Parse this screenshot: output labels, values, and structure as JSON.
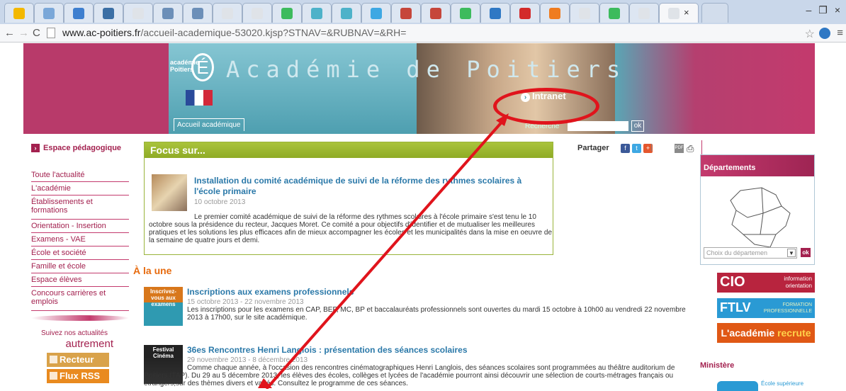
{
  "browser": {
    "url_host": "www.ac-poitiers.fr",
    "url_path": "/accueil-academique-53020.kjsp?STNAV=&RUBNAV=&RH=",
    "active_tab_close": "×",
    "tabs": [
      {
        "icon": "photo-icon",
        "color": "#f3b800"
      },
      {
        "icon": "photo-icon",
        "color": "#7aa7d8"
      },
      {
        "icon": "calendar-icon",
        "color": "#3e7fcf"
      },
      {
        "icon": "blog-icon",
        "color": "#3b6fa5"
      },
      {
        "icon": "page-icon",
        "color": "#dfe3e8"
      },
      {
        "icon": "slide-icon",
        "color": "#6c8fb8"
      },
      {
        "icon": "slide-icon",
        "color": "#6c8fb8"
      },
      {
        "icon": "page-icon",
        "color": "#dfe3e8"
      },
      {
        "icon": "page-icon",
        "color": "#dfe3e8"
      },
      {
        "icon": "drive-icon",
        "color": "#3dbb5d"
      },
      {
        "icon": "circle-icon",
        "color": "#4eb2c9"
      },
      {
        "icon": "circle-icon",
        "color": "#4eb2c9"
      },
      {
        "icon": "twitter-icon",
        "color": "#3ea8e3"
      },
      {
        "icon": "record-icon",
        "color": "#c6463b"
      },
      {
        "icon": "record-icon",
        "color": "#c6463b"
      },
      {
        "icon": "drive-icon",
        "color": "#3dbb5d"
      },
      {
        "icon": "circle-icon",
        "color": "#2f78c4"
      },
      {
        "icon": "free-icon",
        "color": "#d32a2a"
      },
      {
        "icon": "orange-icon",
        "color": "#ef7c1f"
      },
      {
        "icon": "page-icon",
        "color": "#dfe3e8"
      },
      {
        "icon": "drive-icon",
        "color": "#3dbb5d"
      },
      {
        "icon": "page-icon",
        "color": "#dfe3e8"
      }
    ]
  },
  "banner": {
    "logo_text": "académie\nPoitiers",
    "logo_letter": "É",
    "brand": "Académie de Poitiers",
    "accueil_tab": "Accueil académique",
    "intranet_label": "Intranet",
    "search_label": "Recherche",
    "search_button": "ok"
  },
  "left": {
    "espace_pedagogique": "Espace pédagogique",
    "nav": [
      "Toute l'actualité",
      "L'académie",
      "Établissements et formations",
      "Orientation - Insertion",
      "Examens - VAE",
      "École et société",
      "Famille et école",
      "Espace élèves",
      "Concours carrières et emplois"
    ],
    "suivez": "Suivez nos actualités",
    "autrement": "autrement",
    "recteur": "Recteur",
    "rss": "Flux RSS"
  },
  "focus": {
    "header": "Focus sur...",
    "title": "Installation du comité académique de suivi de la réforme des rythmes scolaires à l'école primaire",
    "date": "10 octobre 2013",
    "text": "Le premier comité académique de suivi de la réforme des rythmes scolaires à l'école primaire s'est tenu le 10 octobre sous la présidence du recteur, Jacques Moret. Ce comité a pour objectifs d'identifier et de mutualiser les meilleures pratiques et les solutions les plus efficaces afin de mieux accompagner les écoles et les municipalités dans la mise en oeuvre de la semaine de quatre jours et demi."
  },
  "share": {
    "label": "Partager",
    "sep": "|",
    "pdf": "PDF"
  },
  "alaune": {
    "title": "À la une",
    "news": [
      {
        "img_text": "Inscrivez-vous aux examens",
        "title": "Inscriptions aux examens professionnels",
        "date": "15 octobre 2013 - 22 novembre 2013",
        "text": "Les inscriptions pour les examens en CAP, BEP, MC, BP et baccalauréats professionnels sont ouvertes du mardi 15 octobre à 10h00 au vendredi 22 novembre 2013 à 17h00, sur le site académique."
      },
      {
        "img_text": "Festival Cinéma",
        "title": "36es Rencontres Henri Langlois : présentation des séances scolaires",
        "date": "29 novembre 2013 - 8 décembre 2013",
        "text": "Comme chaque année, à l'occasion des rencontres cinématographiques Henri Langlois, des séances scolaires sont programmées au théâtre auditorium de Poitiers (TAP). Du 29 au 5 décembre 2013, les élèves des écoles, collèges et lycées de l'académie pourront ainsi découvrir une sélection de courts-métrages français ou étrangers,sur des thèmes divers et variés. Consultez le programme de ces séances."
      }
    ]
  },
  "right": {
    "departements": "Départements",
    "select_placeholder": "Choix du départemen",
    "ok": "ok",
    "cio_big": "CIO",
    "cio_small": "information\norientation",
    "ftlv_big": "FTLV",
    "ftlv_small": "FORMATION\nPROFESSIONNELLE",
    "recrute_a": "L'académie ",
    "recrute_b": "recrute",
    "ministere": "Ministère",
    "esen": "École supérieure"
  }
}
